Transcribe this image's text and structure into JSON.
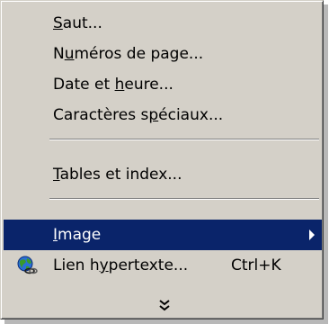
{
  "menu": {
    "items": [
      {
        "pre": "",
        "key": "S",
        "post": "aut..."
      },
      {
        "pre": "N",
        "key": "u",
        "post": "méros de page..."
      },
      {
        "pre": "Date et ",
        "key": "h",
        "post": "eure..."
      },
      {
        "pre": "Caractères s",
        "key": "p",
        "post": "éciaux..."
      },
      {
        "pre": "",
        "key": "T",
        "post": "ables et index..."
      },
      {
        "pre": "",
        "key": "I",
        "post": "mage"
      },
      {
        "pre": "Lien h",
        "key": "y",
        "post": "pertexte...",
        "shortcut": "Ctrl+K"
      }
    ],
    "icons": {
      "hyperlink": "globe-link-icon",
      "submenu": "submenu-arrow-icon",
      "expand": "double-chevron-down-icon"
    },
    "colors": {
      "background": "#d4d0c8",
      "highlight": "#0a246a",
      "highlight_text": "#ffffff"
    }
  }
}
